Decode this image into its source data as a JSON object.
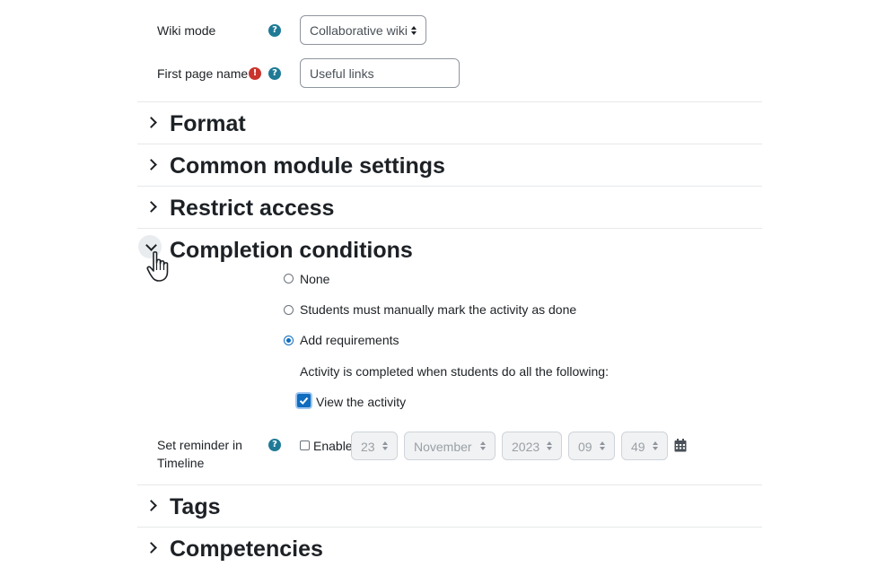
{
  "general": {
    "wiki_mode_label": "Wiki mode",
    "wiki_mode_value": "Collaborative wiki",
    "first_page_label": "First page name",
    "first_page_value": "Useful links",
    "help_glyph": "?",
    "required_glyph": "!"
  },
  "sections": {
    "format": "Format",
    "common": "Common module settings",
    "restrict": "Restrict access",
    "completion": "Completion conditions",
    "tags": "Tags",
    "competencies": "Competencies"
  },
  "completion": {
    "options": [
      "None",
      "Students must manually mark the activity as done",
      "Add requirements"
    ],
    "selected": "Add requirements",
    "requirements_text": "Activity is completed when students do all the following:",
    "view_label": "View the activity",
    "reminder_label_line1": "Set reminder in",
    "reminder_label_line2": "Timeline",
    "enable_label": "Enable",
    "day": "23",
    "month": "November",
    "year": "2023",
    "hour": "09",
    "minute": "49"
  },
  "colors": {
    "accent": "#0f6cbf",
    "help": "#1f7a96",
    "required": "#c9342d"
  },
  "icons": [
    "help-icon",
    "required-icon",
    "chevron-right-icon",
    "chevron-down-icon",
    "calendar-icon",
    "hand-pointer-icon"
  ]
}
